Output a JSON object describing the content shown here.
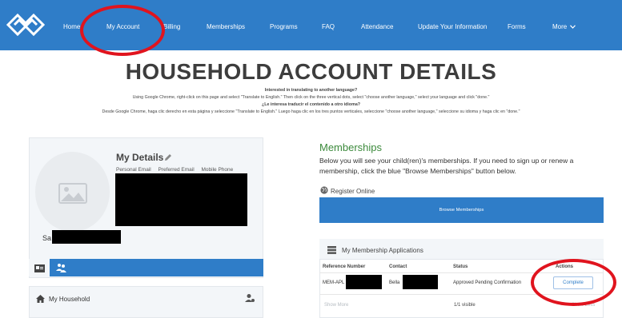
{
  "nav": {
    "items": [
      "Home",
      "My Account",
      "Billing",
      "Memberships",
      "Programs",
      "FAQ",
      "Attendance",
      "Update Your Information",
      "Forms",
      "More"
    ],
    "accent": "#2f7dc8"
  },
  "page": {
    "title": "HOUSEHOLD ACCOUNT DETAILS",
    "translate_en_heading": "Interested in translating to another language?",
    "translate_en_body": "Using Google Chrome, right-click on this page and select \"Translate to English.\" Then click on the three vertical dots, select \"choose another language,\" select your language and click \"done.\"",
    "translate_es_heading": "¿Le interesa traducir el contenido a otro idioma?",
    "translate_es_body": "Desde Google Chrome, haga clic derecho en esta página y seleccione \"Translate to English.\" Luego haga clic en los tres puntos verticales, seleccione \"choose another language,\" seleccione su idioma y haga clic en \"done.\""
  },
  "details": {
    "title": "My Details",
    "labels": [
      "Personal Email",
      "Preferred Email",
      "Mobile Phone"
    ],
    "name_prefix": "Sa"
  },
  "household": {
    "label": "My Household"
  },
  "memberships": {
    "title": "Memberships",
    "description": "Below you will see your child(ren)'s memberships. If you need to sign up or renew a membership, click the blue \"Browse Memberships\" button below.",
    "register_online": "Register Online",
    "browse_button": "Browse Memberships",
    "applications": {
      "title": "My Membership Applications",
      "columns": [
        "Reference Number",
        "Contact",
        "Status",
        "Actions"
      ],
      "rows": [
        {
          "reference_prefix": "MEM-APL",
          "contact_prefix": "Bella",
          "status": "Approved Pending Confirmation",
          "action": "Complete"
        }
      ],
      "show_more": "Show More",
      "visible_count": "1/1 visible",
      "show_less": "Show Less"
    }
  },
  "colors": {
    "annotation": "#e0141e",
    "heading_green": "#3c8a3c"
  }
}
